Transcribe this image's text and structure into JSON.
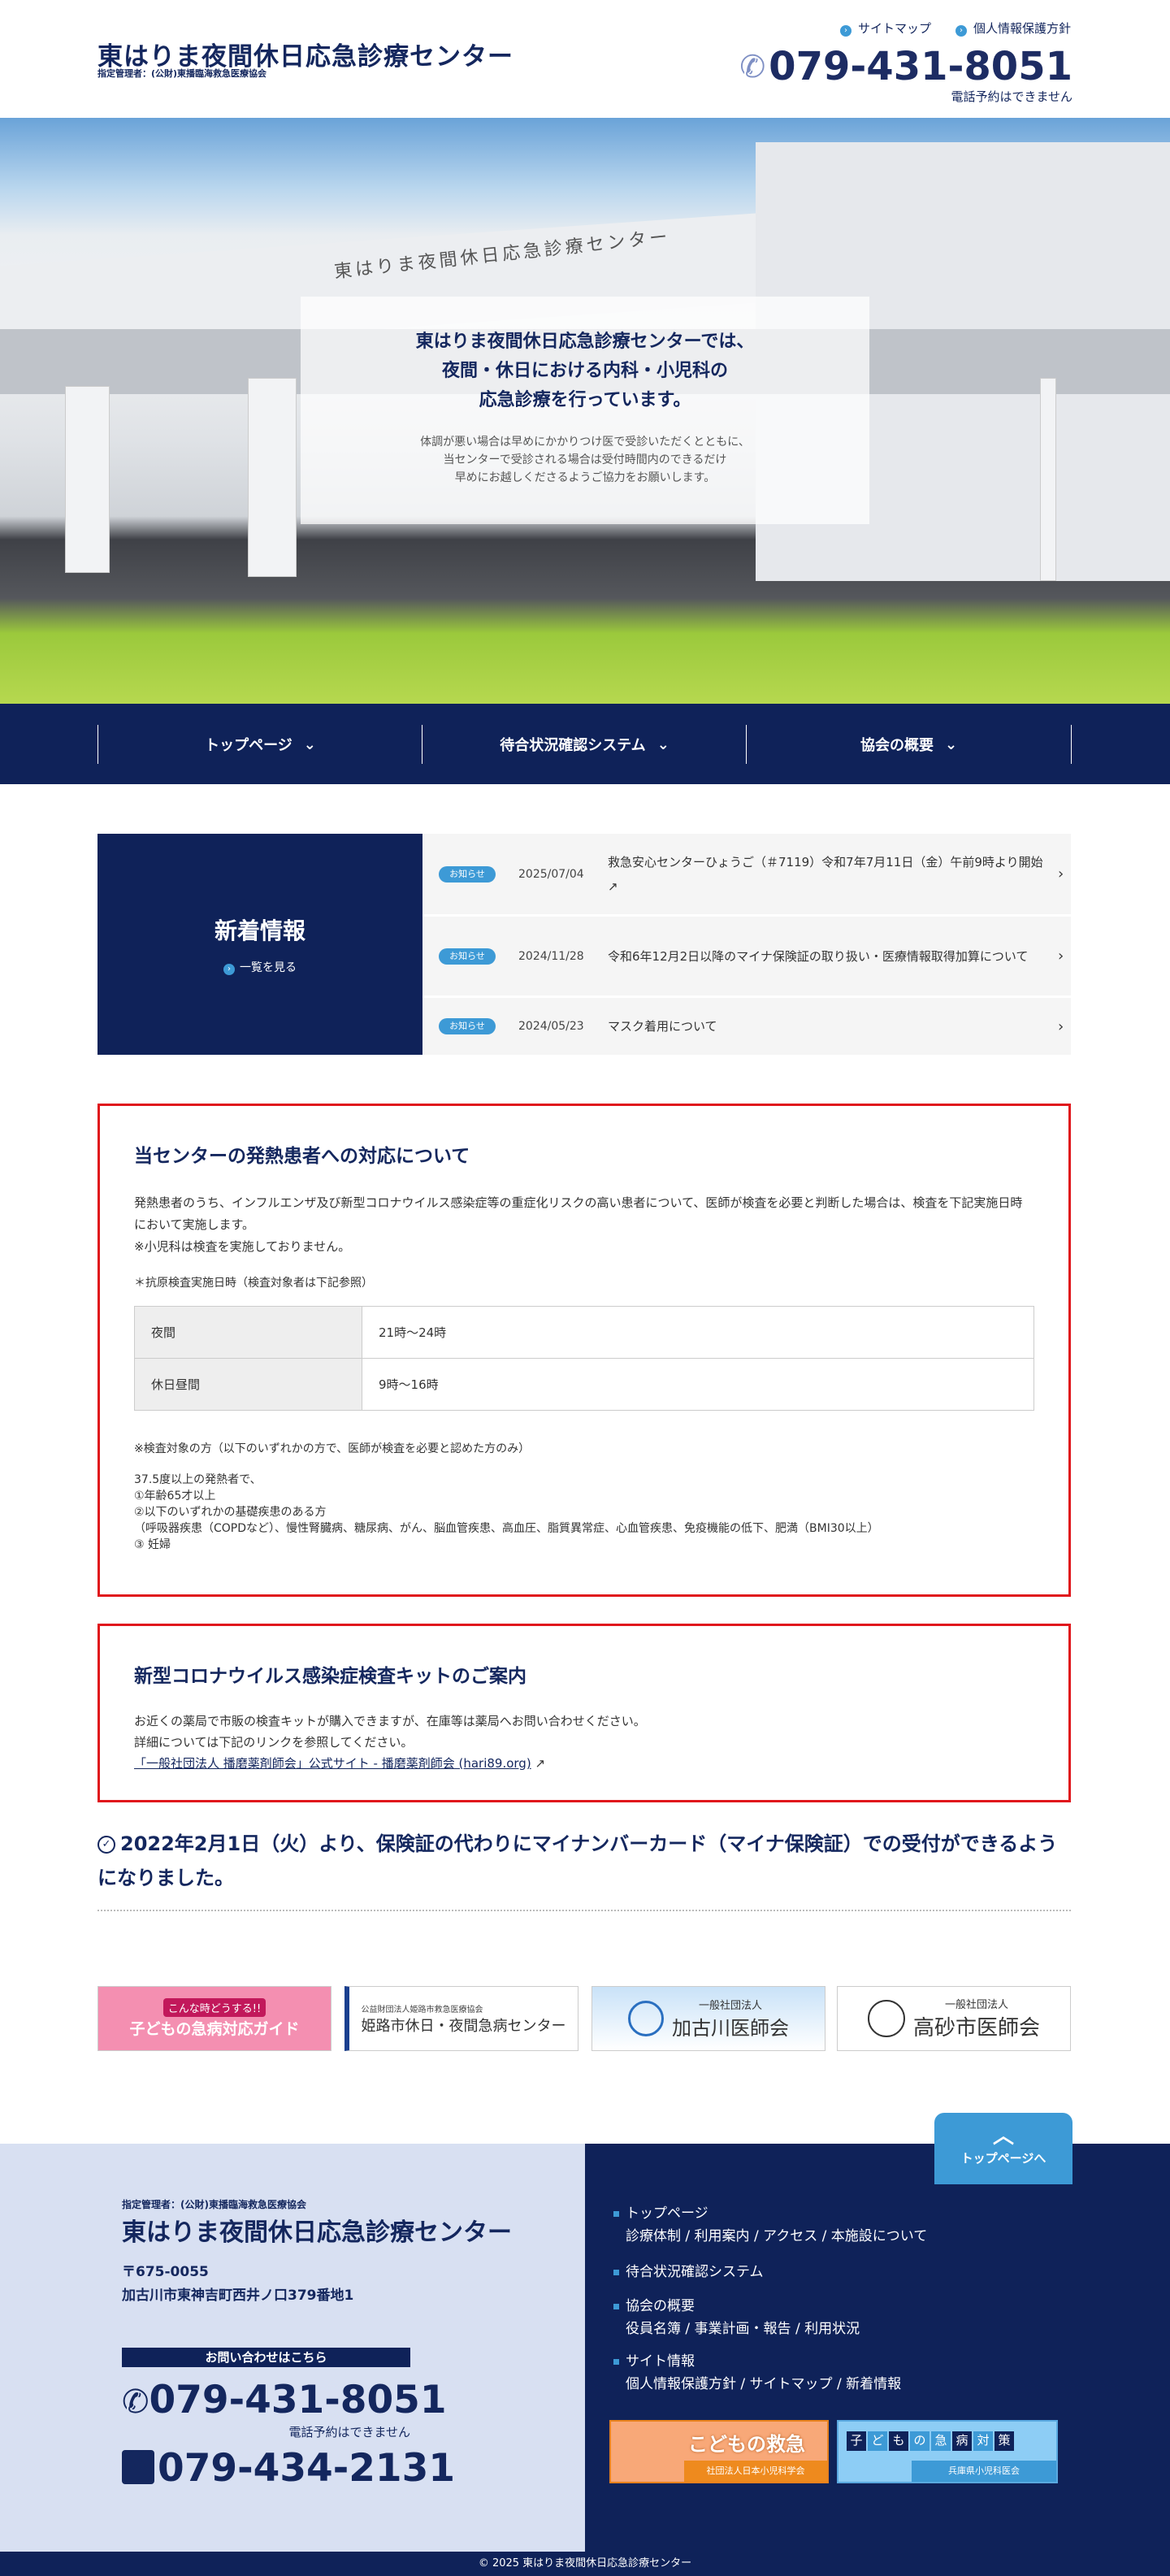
{
  "header": {
    "title": "東はりま夜間休日応急診療センター",
    "subtitle": "指定管理者：(公財)東播臨海救急医療協会",
    "links": [
      "サイトマップ",
      "個人情報保護方針"
    ],
    "phone": "079-431-8051",
    "phone_note": "電話予約はできません"
  },
  "hero": {
    "building_sign": "東はりま夜間休日応急診療センター",
    "heading": [
      "東はりま夜間休日応急診療センターでは、",
      "夜間・休日における内科・小児科の",
      "応急診療を行っています。"
    ],
    "body": [
      "体調が悪い場合は早めにかかりつけ医で受診いただくとともに、",
      "当センターで受診される場合は受付時間内のできるだけ",
      "早めにお越しくださるようご協力をお願いします。"
    ]
  },
  "nav": [
    "トップページ",
    "待合状況確認システム",
    "協会の概要"
  ],
  "news": {
    "title": "新着情報",
    "more": "一覧を見る",
    "items": [
      {
        "badge": "お知らせ",
        "date": "2025/07/04",
        "title": "救急安心センターひょうご（＃7119）令和7年7月11日（金）午前9時より開始"
      },
      {
        "badge": "お知らせ",
        "date": "2024/11/28",
        "title": "令和6年12月2日以降のマイナ保険証の取り扱い・医療情報取得加算について"
      },
      {
        "badge": "お知らせ",
        "date": "2024/05/23",
        "title": "マスク着用について"
      }
    ]
  },
  "fever": {
    "title": "当センターの発熱患者への対応について",
    "p1": "発熱患者のうち、インフルエンザ及び新型コロナウイルス感染症等の重症化リスクの高い患者について、医師が検査を必要と判断した場合は、検査を下記実施日時において実施します。",
    "p2": "※小児科は検査を実施しておりません。",
    "p3": "＊抗原検査実施日時（検査対象者は下記参照）",
    "table": [
      {
        "label": "夜間",
        "value": "21時～24時"
      },
      {
        "label": "休日昼間",
        "value": "9時～16時"
      }
    ],
    "target": "※検査対象の方（以下のいずれかの方で、医師が検査を必要と認めた方のみ）",
    "list": [
      "37.5度以上の発熱者で、",
      "①年齢65才以上",
      "②以下のいずれかの基礎疾患のある方",
      "（呼吸器疾患（COPDなど）、慢性腎臓病、糖尿病、がん、脳血管疾患、高血圧、脂質異常症、心血管疾患、免疫機能の低下、肥満（BMI30以上）",
      "③ 妊婦"
    ]
  },
  "kit": {
    "title": "新型コロナウイルス感染症検査キットのご案内",
    "p1": "お近くの薬局で市販の検査キットが購入できますが、在庫等は薬局へお問い合わせください。",
    "p2": "詳細については下記のリンクを参照してください。",
    "link": "「一般社団法人 播磨薬剤師会」公式サイト - 播磨薬剤師会 (hari89.org)"
  },
  "notice": "2022年2月1日（火）より、保険証の代わりにマイナンバーカード（マイナ保険証）での受付ができるようになりました。",
  "banners": [
    {
      "top": "こんな時どうする!!",
      "main": "子どもの急病対応ガイド"
    },
    {
      "top": "公益財団法人姫路市救急医療協会",
      "main": "姫路市休日・夜間急病センター"
    },
    {
      "top": "一般社団法人",
      "main": "加古川医師会"
    },
    {
      "top": "一般社団法人",
      "main": "高砂市医師会"
    }
  ],
  "footer": {
    "manager": "指定管理者：(公財)東播臨海救急医療協会",
    "title": "東はりま夜間休日応急診療センター",
    "zip": "〒675-0055",
    "address": "加古川市東神吉町西井ノ口379番地1",
    "contact_label": "お問い合わせはこちら",
    "tel": "079-431-8051",
    "tel_note": "電話予約はできません",
    "fax": "079-434-2131",
    "totop": "トップページへ",
    "nav": [
      {
        "head": "トップページ",
        "sub": "診療体制 / 利用案内 / アクセス / 本施設について"
      },
      {
        "head": "待合状況確認システム",
        "sub": ""
      },
      {
        "head": "協会の概要",
        "sub": "役員名簿 / 事業計画・報告 / 利用状況"
      },
      {
        "head": "サイト情報",
        "sub": "個人情報保護方針 / サイトマップ / 新着情報"
      }
    ],
    "banner1": {
      "main": "こどもの救急",
      "sub": "社団法人日本小児科学会"
    },
    "banner2": {
      "chars": [
        "子",
        "ど",
        "も",
        "の",
        "急",
        "病",
        "対",
        "策"
      ],
      "sub": "兵庫県小児科医会"
    },
    "copyright": "© 2025 東はりま夜間休日応急診療センター"
  },
  "colors": {
    "navy": "#0f2259",
    "accent": "#3d9ad6",
    "alert": "#e0161c"
  }
}
